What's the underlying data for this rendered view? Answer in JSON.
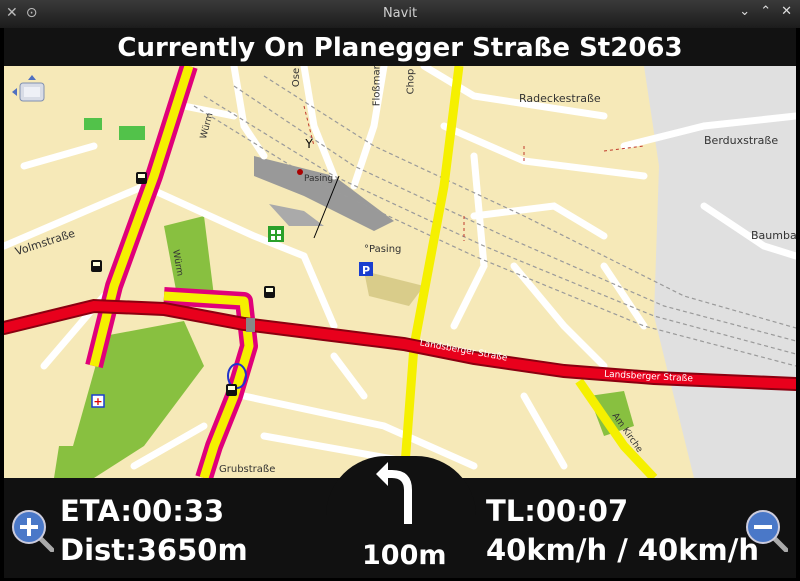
{
  "window": {
    "title": "Navit"
  },
  "street": {
    "current": "Currently On Planegger Straße St2063"
  },
  "map_labels": {
    "radeckestrasse": "Radeckestraße",
    "berduxstrasse": "Berduxstraße",
    "baumba": "Baumba",
    "volmstrasse": "Volmstraße",
    "pasing_station": "Pasing",
    "pasing_place": "°Pasing",
    "landsberger_1": "Landsberger Straße",
    "landsberger_2": "Landsberger Straße",
    "am_kirche": "Am Kirche",
    "wurm_1": "Würm",
    "wurm_2": "Würm",
    "flosmann": "Floßmann",
    "chop": "Chop",
    "ose": "Ose",
    "grubstrasse": "Grubstraße"
  },
  "nav": {
    "eta": "ETA:00:33",
    "dist": "Dist:3650m",
    "tl": "TL:00:07",
    "speed": "40km/h / 40km/h",
    "turn_distance": "100m"
  },
  "icons": {
    "zoom_in": "zoom-in-magnifier",
    "zoom_out": "zoom-out-magnifier",
    "turn": "turn-left-arrow"
  },
  "colors": {
    "route_red": "#e8001c",
    "highway_yellow": "#f5f000",
    "highway_border": "#e0007a",
    "land": "#f6e9b8",
    "green": "#88c040"
  }
}
